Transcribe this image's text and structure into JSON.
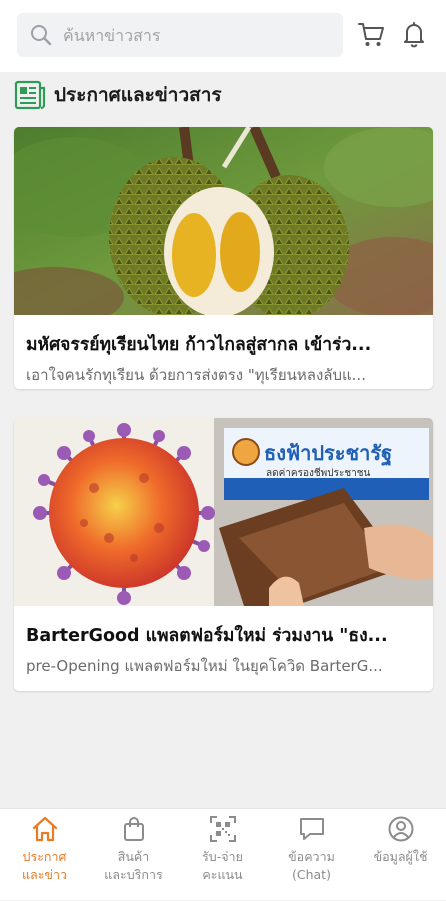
{
  "search": {
    "placeholder": "ค้นหาข่าวสาร"
  },
  "header": {
    "cart_icon": "cart-icon",
    "bell_icon": "bell-icon"
  },
  "section": {
    "title": "ประกาศและข่าวสาร",
    "icon": "newspaper-icon"
  },
  "news": [
    {
      "title": "มหัศจรรย์ทุเรียนไทย ก้าวไกลสู่สากล เข้าร่ว...",
      "description": "เอาใจคนรักทุเรียน ด้วยการส่งตรง \"ทุเรียนหลงลับแ...",
      "image": "durian-photo"
    },
    {
      "title": "BarterGood แพลตฟอร์มใหม่ ร่วมงาน \"ธง...",
      "description": "pre-Opening แพลตฟอร์มใหม่ ในยุคโควิด BarterG...",
      "image": "virus-wallet-photo",
      "image_texts": {
        "banner_title": "ธงฟ้าประชารัฐ",
        "banner_sub": "ลดค่าครองชีพประชาชน"
      }
    }
  ],
  "tabs": [
    {
      "line1": "ประกาศ",
      "line2": "และข่าว",
      "icon": "home-icon",
      "active": true
    },
    {
      "line1": "สินค้า",
      "line2": "และบริการ",
      "icon": "shopping-bag-icon",
      "active": false
    },
    {
      "line1": "รับ-จ่าย",
      "line2": "คะแนน",
      "icon": "qr-code-icon",
      "active": false
    },
    {
      "line1": "ข้อความ",
      "line2": "(Chat)",
      "icon": "chat-icon",
      "active": false
    },
    {
      "line1": "ข้อมูลผู้ใช้",
      "line2": "",
      "icon": "user-icon",
      "active": false
    }
  ],
  "colors": {
    "accent": "#e87b25",
    "inactive": "#8c8c8c",
    "section_icon": "#2e9b57"
  }
}
